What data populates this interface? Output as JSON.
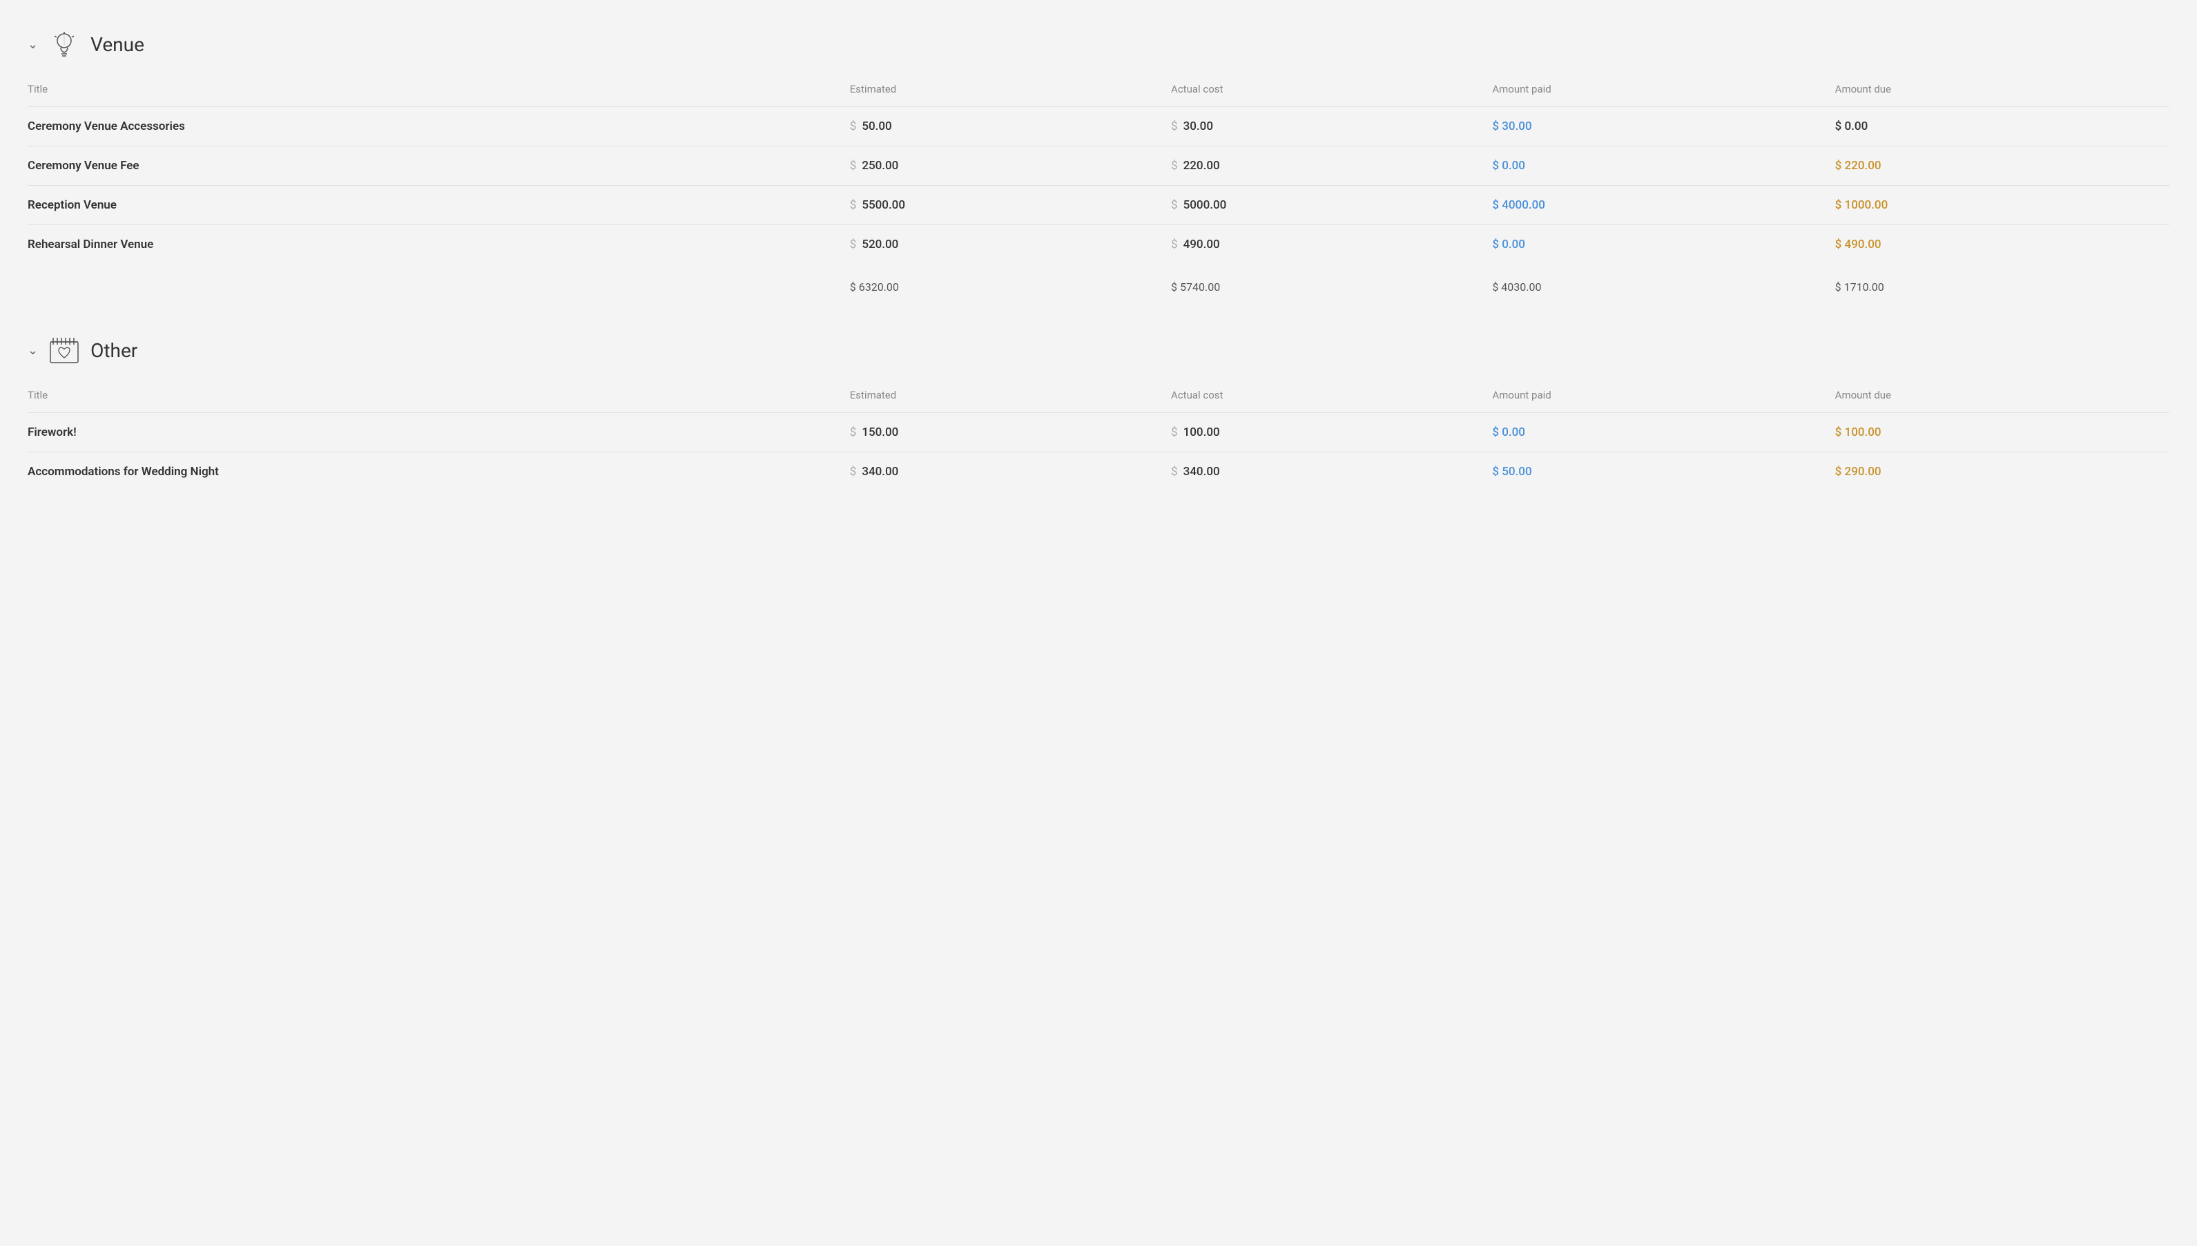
{
  "sections": [
    {
      "id": "venue",
      "title": "Venue",
      "icon": "bulb",
      "columns": {
        "title": "Title",
        "estimated": "Estimated",
        "actual": "Actual cost",
        "paid": "Amount paid",
        "due": "Amount due"
      },
      "rows": [
        {
          "title": "Ceremony Venue Accessories",
          "estimated": "50.00",
          "actual": "30.00",
          "paid": "30.00",
          "due": "0.00",
          "paid_color": "blue",
          "due_color": "normal"
        },
        {
          "title": "Ceremony Venue Fee",
          "estimated": "250.00",
          "actual": "220.00",
          "paid": "0.00",
          "due": "220.00",
          "paid_color": "blue",
          "due_color": "orange"
        },
        {
          "title": "Reception Venue",
          "estimated": "5500.00",
          "actual": "5000.00",
          "paid": "4000.00",
          "due": "1000.00",
          "paid_color": "blue",
          "due_color": "orange"
        },
        {
          "title": "Rehearsal Dinner Venue",
          "estimated": "520.00",
          "actual": "490.00",
          "paid": "0.00",
          "due": "490.00",
          "paid_color": "blue",
          "due_color": "orange"
        }
      ],
      "totals": {
        "estimated": "$ 6320.00",
        "actual": "$ 5740.00",
        "paid": "$ 4030.00",
        "due": "$ 1710.00"
      }
    },
    {
      "id": "other",
      "title": "Other",
      "icon": "heart-box",
      "columns": {
        "title": "Title",
        "estimated": "Estimated",
        "actual": "Actual cost",
        "paid": "Amount paid",
        "due": "Amount due"
      },
      "rows": [
        {
          "title": "Firework!",
          "estimated": "150.00",
          "actual": "100.00",
          "paid": "0.00",
          "due": "100.00",
          "paid_color": "blue",
          "due_color": "orange"
        },
        {
          "title": "Accommodations for Wedding Night",
          "estimated": "340.00",
          "actual": "340.00",
          "paid": "50.00",
          "due": "290.00",
          "paid_color": "blue",
          "due_color": "orange"
        }
      ],
      "totals": null
    }
  ]
}
